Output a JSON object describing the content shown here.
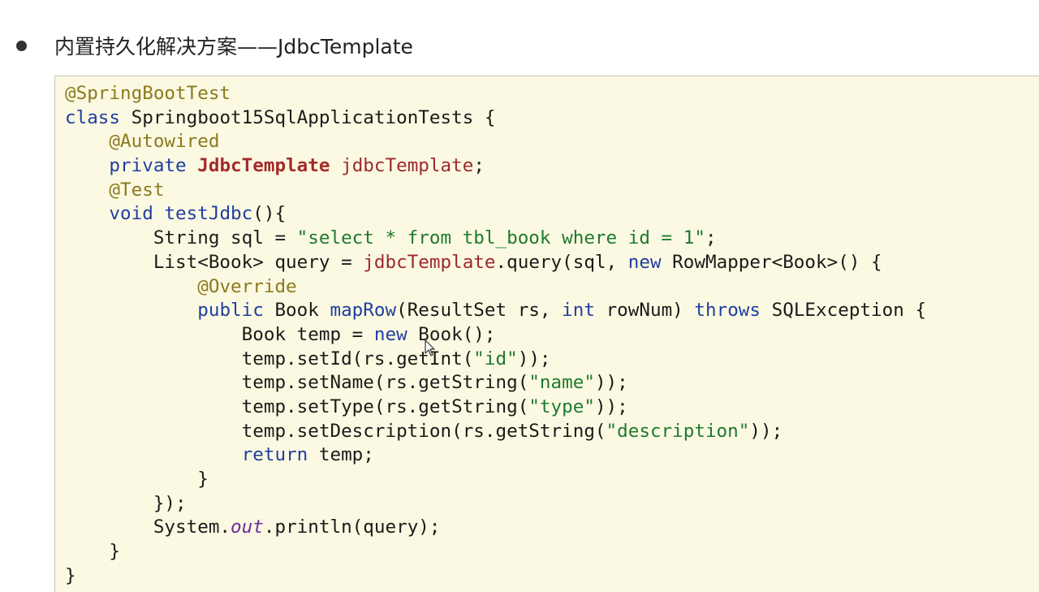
{
  "heading": {
    "text": "内置持久化解决方案——JdbcTemplate"
  },
  "code_lines": [
    [
      {
        "t": "@SpringBootTest",
        "c": "ann"
      }
    ],
    [
      {
        "t": "class ",
        "c": "kw"
      },
      {
        "t": "Springboot15SqlApplicationTests {",
        "c": ""
      }
    ],
    [
      {
        "t": "    ",
        "c": ""
      },
      {
        "t": "@Autowired",
        "c": "ann"
      }
    ],
    [
      {
        "t": "    ",
        "c": ""
      },
      {
        "t": "private ",
        "c": "kw"
      },
      {
        "t": "JdbcTemplate",
        "c": "cls"
      },
      {
        "t": " ",
        "c": ""
      },
      {
        "t": "jdbcTemplate",
        "c": "fld"
      },
      {
        "t": ";",
        "c": ""
      }
    ],
    [
      {
        "t": "    ",
        "c": ""
      },
      {
        "t": "@Test",
        "c": "ann"
      }
    ],
    [
      {
        "t": "    ",
        "c": ""
      },
      {
        "t": "void ",
        "c": "kw"
      },
      {
        "t": "testJdbc",
        "c": "fn"
      },
      {
        "t": "(){",
        "c": ""
      }
    ],
    [
      {
        "t": "        String sql = ",
        "c": ""
      },
      {
        "t": "\"select * from tbl_book where id = 1\"",
        "c": "str"
      },
      {
        "t": ";",
        "c": ""
      }
    ],
    [
      {
        "t": "        List<Book> query = ",
        "c": ""
      },
      {
        "t": "jdbcTemplate",
        "c": "fld"
      },
      {
        "t": ".query(sql, ",
        "c": ""
      },
      {
        "t": "new ",
        "c": "kw"
      },
      {
        "t": "RowMapper<Book>() {",
        "c": ""
      }
    ],
    [
      {
        "t": "            ",
        "c": ""
      },
      {
        "t": "@Override",
        "c": "ann"
      }
    ],
    [
      {
        "t": "            ",
        "c": ""
      },
      {
        "t": "public ",
        "c": "kw"
      },
      {
        "t": "Book ",
        "c": ""
      },
      {
        "t": "mapRow",
        "c": "fn"
      },
      {
        "t": "(ResultSet rs, ",
        "c": ""
      },
      {
        "t": "int ",
        "c": "kw"
      },
      {
        "t": "rowNum) ",
        "c": ""
      },
      {
        "t": "throws ",
        "c": "kw"
      },
      {
        "t": "SQLException {",
        "c": ""
      }
    ],
    [
      {
        "t": "                Book temp = ",
        "c": ""
      },
      {
        "t": "new ",
        "c": "kw"
      },
      {
        "t": "Book();",
        "c": ""
      }
    ],
    [
      {
        "t": "                temp.setId(rs.getInt(",
        "c": ""
      },
      {
        "t": "\"id\"",
        "c": "str"
      },
      {
        "t": "));",
        "c": ""
      }
    ],
    [
      {
        "t": "                temp.setName(rs.getString(",
        "c": ""
      },
      {
        "t": "\"name\"",
        "c": "str"
      },
      {
        "t": "));",
        "c": ""
      }
    ],
    [
      {
        "t": "                temp.setType(rs.getString(",
        "c": ""
      },
      {
        "t": "\"type\"",
        "c": "str"
      },
      {
        "t": "));",
        "c": ""
      }
    ],
    [
      {
        "t": "                temp.setDescription(rs.getString(",
        "c": ""
      },
      {
        "t": "\"description\"",
        "c": "str"
      },
      {
        "t": "));",
        "c": ""
      }
    ],
    [
      {
        "t": "                ",
        "c": ""
      },
      {
        "t": "return ",
        "c": "kw"
      },
      {
        "t": "temp;",
        "c": ""
      }
    ],
    [
      {
        "t": "            }",
        "c": ""
      }
    ],
    [
      {
        "t": "        });",
        "c": ""
      }
    ],
    [
      {
        "t": "        System.",
        "c": ""
      },
      {
        "t": "out",
        "c": "sfld"
      },
      {
        "t": ".println(query);",
        "c": ""
      }
    ],
    [
      {
        "t": "    }",
        "c": ""
      }
    ],
    [
      {
        "t": "}",
        "c": ""
      }
    ]
  ],
  "icons": {
    "bullet": "bullet-dot-icon",
    "cursor": "mouse-pointer-icon"
  }
}
